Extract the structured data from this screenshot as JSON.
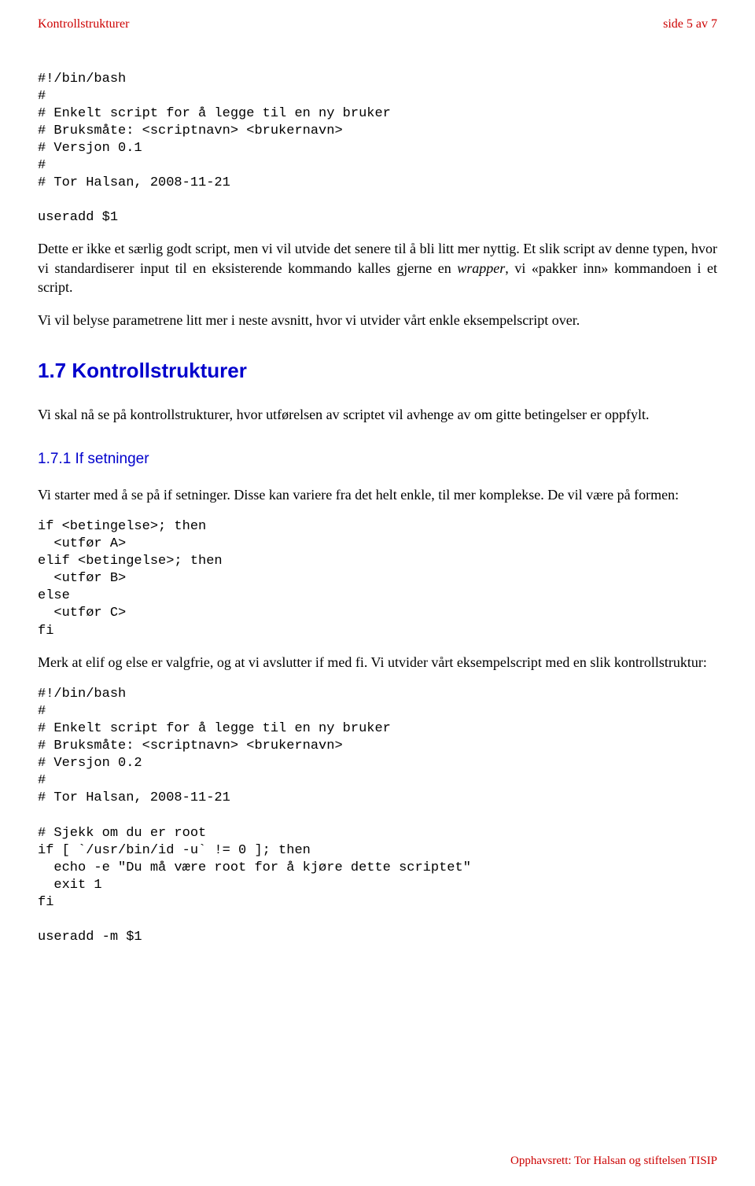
{
  "header": {
    "left": "Kontrollstrukturer",
    "right": "side 5 av 7"
  },
  "code1": "#!/bin/bash\n#\n# Enkelt script for å legge til en ny bruker\n# Bruksmåte: <scriptnavn> <brukernavn>\n# Versjon 0.1\n#\n# Tor Halsan, 2008-11-21\n\nuseradd $1",
  "para1_a": "Dette er ikke et særlig godt script, men vi vil utvide det senere til å bli litt mer nyttig. Et slik script av denne typen, hvor vi standardiserer input til en eksisterende kommando kalles gjerne en ",
  "para1_wrapper": "wrapper",
  "para1_b": ", vi «pakker inn» kommandoen i et script.",
  "para2": "Vi vil belyse parametrene litt mer i neste avsnitt, hvor vi utvider vårt enkle eksempelscript over.",
  "section_title": "1.7 Kontrollstrukturer",
  "para3": "Vi skal nå se på kontrollstrukturer, hvor utførelsen av scriptet vil avhenge av om gitte betingelser er oppfylt.",
  "subsection_title": "1.7.1 If setninger",
  "para4": "Vi starter med å se på if setninger. Disse kan variere fra det helt enkle, til mer komplekse. De vil være på formen:",
  "code2": "if <betingelse>; then\n  <utfør A>\nelif <betingelse>; then\n  <utfør B>\nelse\n  <utfør C>\nfi",
  "para5": "Merk at elif og else er valgfrie, og at vi avslutter if med fi. Vi utvider vårt eksempelscript med en slik kontrollstruktur:",
  "code3": "#!/bin/bash\n#\n# Enkelt script for å legge til en ny bruker\n# Bruksmåte: <scriptnavn> <brukernavn>\n# Versjon 0.2\n#\n# Tor Halsan, 2008-11-21\n\n# Sjekk om du er root\nif [ `/usr/bin/id -u` != 0 ]; then\n  echo -e \"Du må være root for å kjøre dette scriptet\"\n  exit 1\nfi\n\nuseradd -m $1",
  "footer": "Opphavsrett: Tor Halsan og stiftelsen TISIP"
}
